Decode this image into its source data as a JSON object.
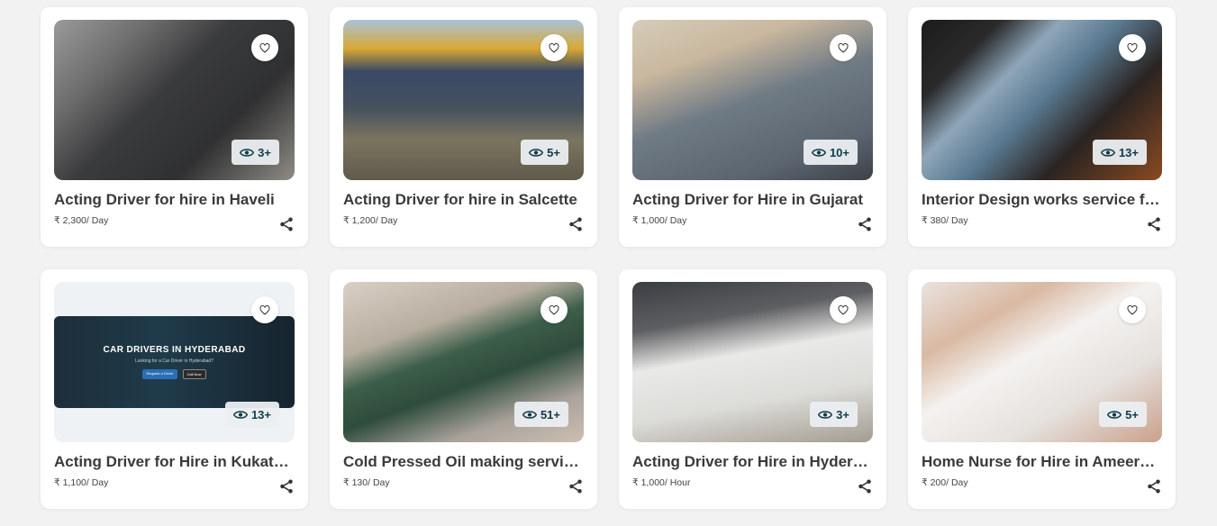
{
  "listings": [
    {
      "title": "Acting Driver for hire in Haveli",
      "price": "₹ 2,300/ Day",
      "views": "3+",
      "image": "haveli"
    },
    {
      "title": "Acting Driver for hire in Salcette",
      "price": "₹ 1,200/ Day",
      "views": "5+",
      "image": "salcette"
    },
    {
      "title": "Acting Driver for Hire in Gujarat",
      "price": "₹ 1,000/ Day",
      "views": "10+",
      "image": "gujarat"
    },
    {
      "title": "Interior Design works service fo...",
      "price": "₹ 380/ Day",
      "views": "13+",
      "image": "interior"
    },
    {
      "title": "Acting Driver for Hire in Kukatp...",
      "price": "₹ 1,100/ Day",
      "views": "13+",
      "image": "kukat",
      "banner": {
        "title": "CAR DRIVERS IN HYDERABAD",
        "subtitle": "Looking for a Car Driver in Hyderabad?",
        "primary_btn": "Request a Driver",
        "secondary_btn": "Call Now"
      }
    },
    {
      "title": "Cold Pressed Oil making servic...",
      "price": "₹ 130/ Day",
      "views": "51+",
      "image": "oil"
    },
    {
      "title": "Acting Driver for Hire in Hydera...",
      "price": "₹ 1,000/ Hour",
      "views": "3+",
      "image": "hyd"
    },
    {
      "title": "Home Nurse for Hire in Ameerpet",
      "price": "₹ 200/ Day",
      "views": "5+",
      "image": "nurse"
    }
  ],
  "icons": {
    "favorite": "heart-outline-icon",
    "views": "eye-icon",
    "share": "share-icon"
  },
  "colors": {
    "views_text": "#0f3b4a",
    "title_text": "#3a3a3a",
    "background": "#f2f2f2"
  }
}
